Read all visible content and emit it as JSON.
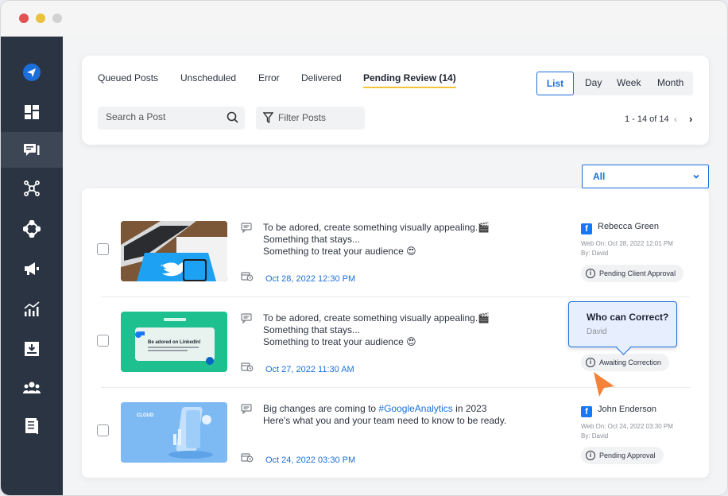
{
  "tabs": [
    {
      "label": "Queued Posts"
    },
    {
      "label": "Unscheduled"
    },
    {
      "label": "Error"
    },
    {
      "label": "Delivered"
    },
    {
      "label": "Pending Review (14)"
    }
  ],
  "view_options": [
    "List",
    "Day",
    "Week",
    "Month"
  ],
  "search": {
    "placeholder": "Search a Post"
  },
  "filter": {
    "label": "Filter Posts"
  },
  "pagination": {
    "label": "1 - 14 of 14"
  },
  "account_filter": {
    "selected": "All"
  },
  "posts": [
    {
      "lines": [
        "To be adored, create something visually appealing.🎬",
        "Something that stays...",
        "Something to treat your audience 😍"
      ],
      "date": "Oct 28, 2022 12:30 PM",
      "author": "Rebecca Green",
      "web_on": "Web On: Oct 28, 2022 12:01 PM",
      "by": "By: David",
      "status": "Pending Client Approval"
    },
    {
      "lines": [
        "To be adored, create something visually appealing.🎬",
        "Something that stays...",
        "Something to treat your audience 😍"
      ],
      "date": "Oct 27, 2022 11:30 AM",
      "status": "Awaiting Correction",
      "thumb_title": "Be adored on LinkedIn!"
    },
    {
      "line1_pre": "Big changes are coming to ",
      "line1_tag": "#GoogleAnalytics",
      "line1_post": " in 2023",
      "line2": "Here's what you and your team need to know to be ready.",
      "date": "Oct 24, 2022 03:30 PM",
      "author": "John Enderson",
      "web_on": "Web On: Oct 24, 2022 03:30 PM",
      "by": "By: David",
      "status": "Pending Approval",
      "thumb_title": "CLOUD"
    }
  ],
  "tooltip": {
    "title": "Who can Correct?",
    "subtitle": "David"
  },
  "colors": {
    "accent": "#1c6fdb",
    "tab_underline": "#f5c33b",
    "sidebar": "#2b3442",
    "cursor": "#f4823b"
  }
}
